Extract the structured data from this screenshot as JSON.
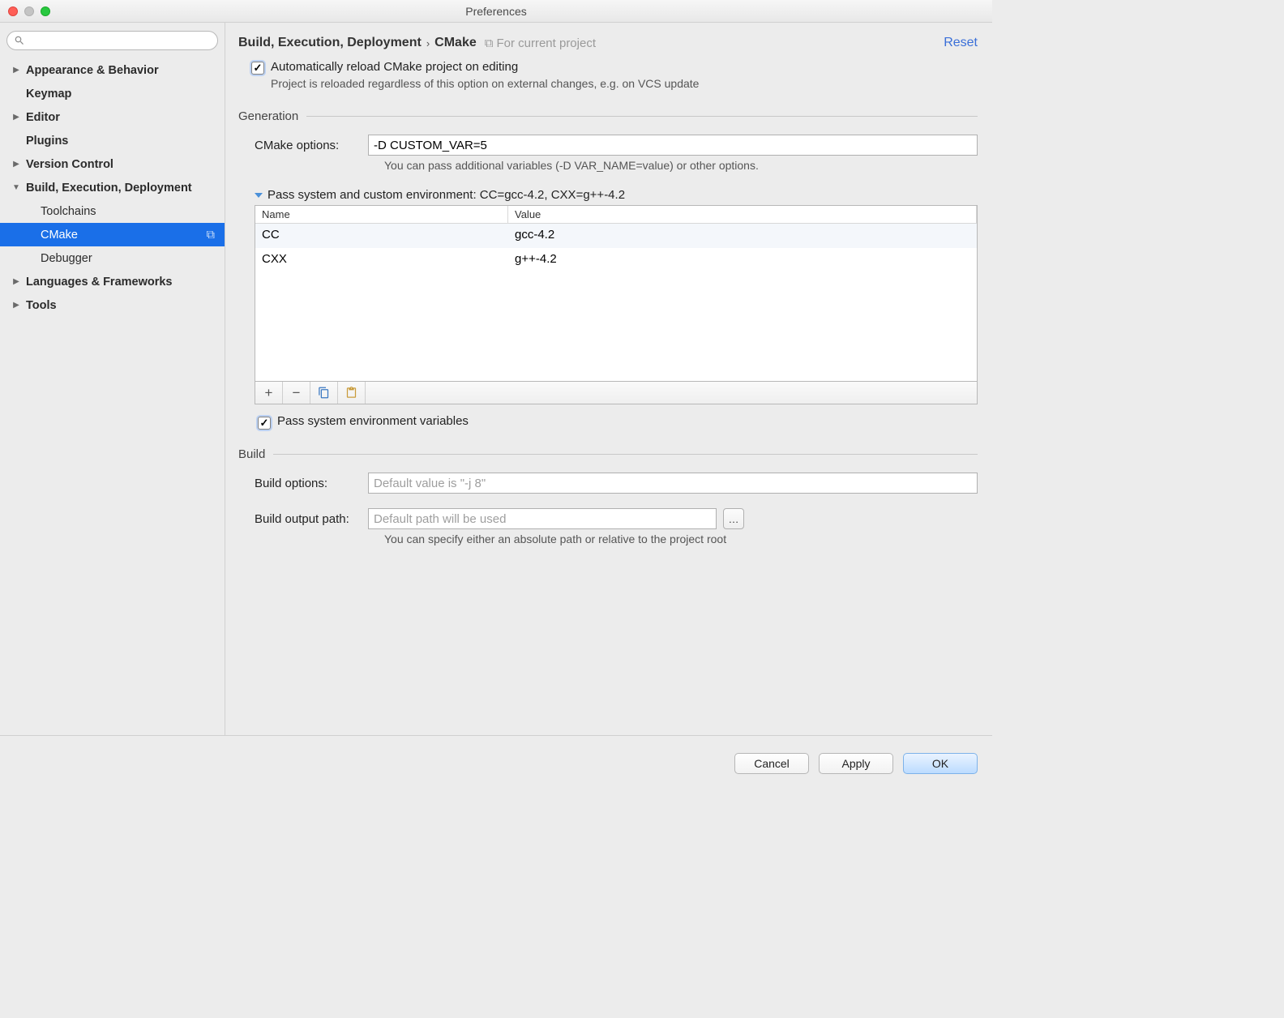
{
  "window": {
    "title": "Preferences"
  },
  "sidebar": {
    "search_placeholder": "",
    "items": [
      {
        "label": "Appearance & Behavior",
        "expandable": true,
        "expanded": false,
        "level": 0
      },
      {
        "label": "Keymap",
        "expandable": false,
        "level": 0
      },
      {
        "label": "Editor",
        "expandable": true,
        "expanded": false,
        "level": 0
      },
      {
        "label": "Plugins",
        "expandable": false,
        "level": 0
      },
      {
        "label": "Version Control",
        "expandable": true,
        "expanded": false,
        "level": 0
      },
      {
        "label": "Build, Execution, Deployment",
        "expandable": true,
        "expanded": true,
        "level": 0
      },
      {
        "label": "Toolchains",
        "expandable": false,
        "level": 1
      },
      {
        "label": "CMake",
        "expandable": false,
        "level": 1,
        "selected": true
      },
      {
        "label": "Debugger",
        "expandable": false,
        "level": 1
      },
      {
        "label": "Languages & Frameworks",
        "expandable": true,
        "expanded": false,
        "level": 0
      },
      {
        "label": "Tools",
        "expandable": true,
        "expanded": false,
        "level": 0
      }
    ]
  },
  "header": {
    "crumb1": "Build, Execution, Deployment",
    "crumb2": "CMake",
    "scope": "For current project",
    "reset": "Reset"
  },
  "autoreload": {
    "label": "Automatically reload CMake project on editing",
    "hint": "Project is reloaded regardless of this option on external changes, e.g. on VCS update",
    "checked": true
  },
  "generation": {
    "title": "Generation",
    "cmake_options_label": "CMake options:",
    "cmake_options_value": "-D CUSTOM_VAR=5",
    "cmake_options_hint": "You can pass additional variables (-D VAR_NAME=value) or other options.",
    "env_heading": "Pass system and custom environment: CC=gcc-4.2, CXX=g++-4.2",
    "table": {
      "col_name": "Name",
      "col_value": "Value",
      "rows": [
        {
          "name": "CC",
          "value": "gcc-4.2",
          "selected": true
        },
        {
          "name": "CXX",
          "value": "g++-4.2"
        }
      ]
    },
    "pass_system_label": "Pass system environment variables",
    "pass_system_checked": true
  },
  "build": {
    "title": "Build",
    "options_label": "Build options:",
    "options_placeholder": "Default value is \"-j 8\"",
    "output_label": "Build output path:",
    "output_placeholder": "Default path will be used",
    "output_hint": "You can specify either an absolute path or relative to the project root"
  },
  "footer": {
    "cancel": "Cancel",
    "apply": "Apply",
    "ok": "OK"
  }
}
